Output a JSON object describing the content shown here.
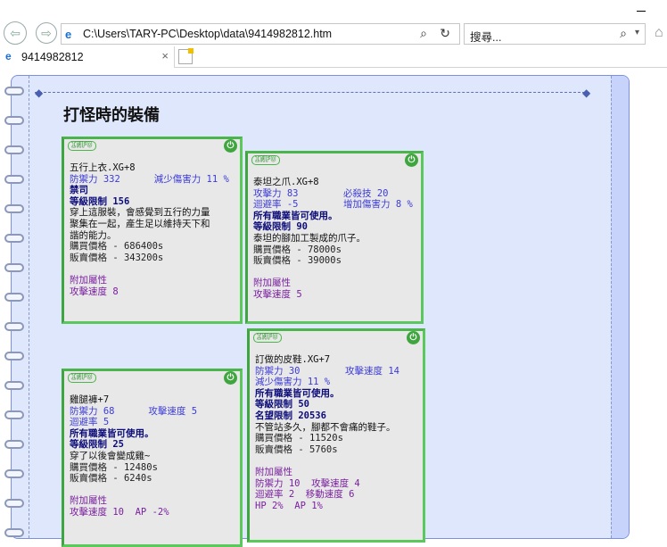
{
  "browser": {
    "address": "C:\\Users\\TARY-PC\\Desktop\\data\\9414982812.htm",
    "search_placeholder": "搜尋...",
    "tab_title": "9414982812"
  },
  "page": {
    "title": "打怪時的裝備"
  },
  "cards": [
    {
      "info_label": "INFO",
      "lines": [
        {
          "text": "五行上衣.XG+8",
          "cls": "black"
        },
        {
          "text": "防禦力 332      減少傷害力 11 %",
          "cls": "blue"
        },
        {
          "text": "禁司",
          "cls": "navy"
        },
        {
          "text": "等級限制 156",
          "cls": "navy"
        },
        {
          "text": "穿上這服裝，會感覺到五行的力量",
          "cls": "black"
        },
        {
          "text": "聚集在一起，產生足以維持天下和",
          "cls": "black"
        },
        {
          "text": "諧的能力。",
          "cls": "black"
        },
        {
          "text": "購買價格 - 686400s",
          "cls": "gray"
        },
        {
          "text": "販賣價格 - 343200s",
          "cls": "gray"
        },
        {
          "text": " ",
          "cls": "gray"
        },
        {
          "text": "附加屬性",
          "cls": "purple"
        },
        {
          "text": "攻擊速度 8",
          "cls": "purple"
        }
      ]
    },
    {
      "info_label": "INFO",
      "lines": [
        {
          "text": "泰坦之爪.XG+8",
          "cls": "black"
        },
        {
          "text": "攻擊力 83        必殺技 20",
          "cls": "blue"
        },
        {
          "text": "迴避率 -5        增加傷害力 8 %",
          "cls": "blue"
        },
        {
          "text": "所有職業皆可使用。",
          "cls": "navy"
        },
        {
          "text": "等級限制 90",
          "cls": "navy"
        },
        {
          "text": "泰坦的腳加工製成的爪子。",
          "cls": "black"
        },
        {
          "text": "購買價格 - 78000s",
          "cls": "gray"
        },
        {
          "text": "販賣價格 - 39000s",
          "cls": "gray"
        },
        {
          "text": " ",
          "cls": "gray"
        },
        {
          "text": "附加屬性",
          "cls": "purple"
        },
        {
          "text": "攻擊速度 5",
          "cls": "purple"
        }
      ]
    },
    {
      "info_label": "INFO",
      "lines": [
        {
          "text": "訂做的皮鞋.XG+7",
          "cls": "black"
        },
        {
          "text": "防禦力 30        攻擊速度 14",
          "cls": "blue"
        },
        {
          "text": "減少傷害力 11 %",
          "cls": "blue"
        },
        {
          "text": "所有職業皆可使用。",
          "cls": "navy"
        },
        {
          "text": "等級限制 50",
          "cls": "navy"
        },
        {
          "text": "名望限制 20536",
          "cls": "navy"
        },
        {
          "text": "不管站多久，腳都不會痛的鞋子。",
          "cls": "black"
        },
        {
          "text": "購買價格 - 11520s",
          "cls": "gray"
        },
        {
          "text": "販賣價格 - 5760s",
          "cls": "gray"
        },
        {
          "text": " ",
          "cls": "gray"
        },
        {
          "text": "附加屬性",
          "cls": "purple"
        },
        {
          "text": "防禦力 10  攻擊速度 4",
          "cls": "purple"
        },
        {
          "text": "迴避率 2  移動速度 6",
          "cls": "purple"
        },
        {
          "text": "HP 2%  AP 1%",
          "cls": "purple"
        }
      ]
    },
    {
      "info_label": "INFO",
      "lines": [
        {
          "text": "雞腿褲+7",
          "cls": "black"
        },
        {
          "text": "防禦力 68      攻擊速度 5",
          "cls": "blue"
        },
        {
          "text": "迴避率 5",
          "cls": "blue"
        },
        {
          "text": "所有職業皆可使用。",
          "cls": "navy"
        },
        {
          "text": "等級限制 25",
          "cls": "navy"
        },
        {
          "text": "穿了以後會變成雞~",
          "cls": "black"
        },
        {
          "text": "購買價格 - 12480s",
          "cls": "gray"
        },
        {
          "text": "販賣價格 - 6240s",
          "cls": "gray"
        },
        {
          "text": " ",
          "cls": "gray"
        },
        {
          "text": "附加屬性",
          "cls": "purple"
        },
        {
          "text": "攻擊速度 10  AP -2%",
          "cls": "purple"
        }
      ]
    }
  ]
}
